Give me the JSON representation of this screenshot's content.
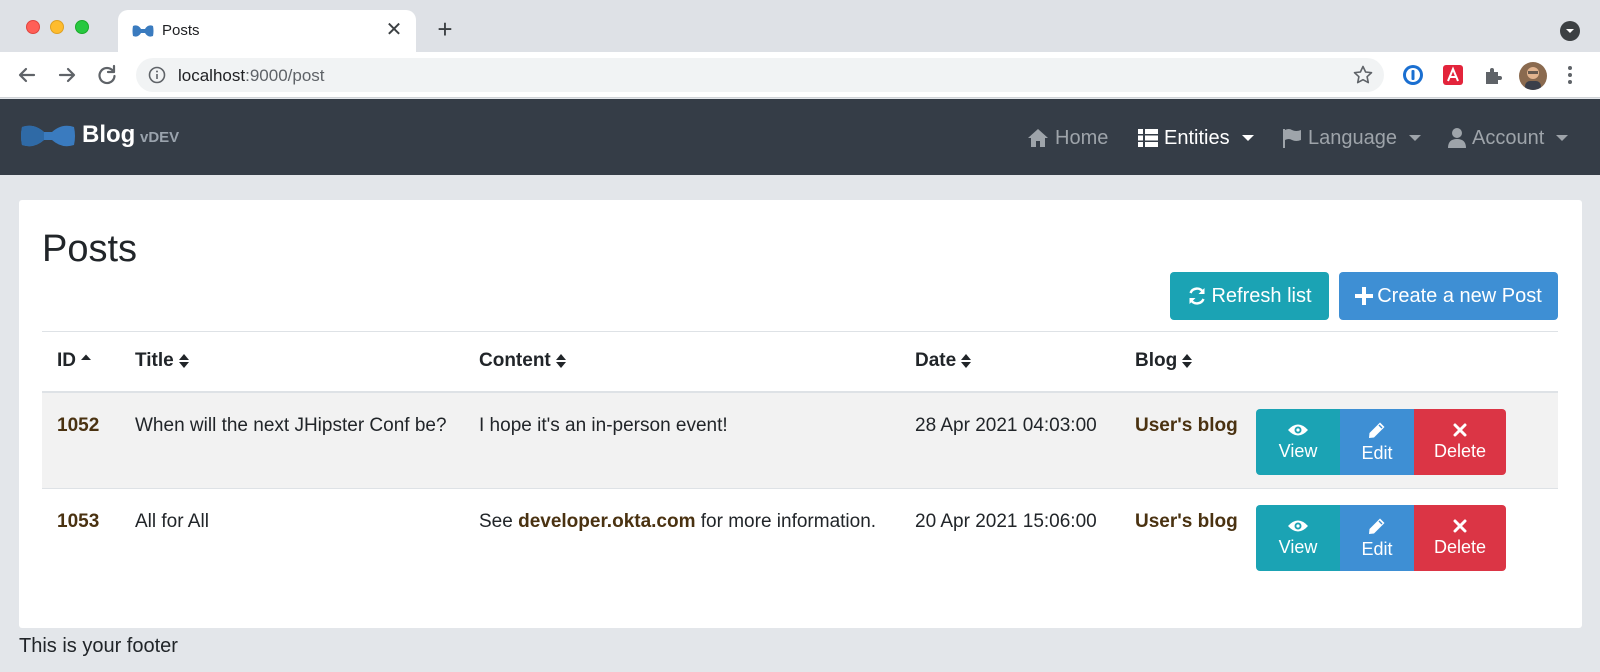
{
  "browser": {
    "tab_title": "Posts",
    "url_host": "localhost",
    "url_rest": ":9000/post"
  },
  "navbar": {
    "brand_title": "Blog",
    "brand_version": "vDEV",
    "items": [
      {
        "label": "Home",
        "icon": "home-icon"
      },
      {
        "label": "Entities",
        "icon": "th-list-icon"
      },
      {
        "label": "Language",
        "icon": "flag-icon"
      },
      {
        "label": "Account",
        "icon": "user-icon"
      }
    ]
  },
  "main": {
    "title": "Posts",
    "refresh_label": "Refresh list",
    "create_label": "Create a new Post",
    "columns": [
      "ID",
      "Title",
      "Content",
      "Date",
      "Blog"
    ],
    "rows": [
      {
        "id": "1052",
        "title": "When will the next JHipster Conf be?",
        "content_pre": "I hope it's an in-person event!",
        "content_link": "",
        "content_post": "",
        "date": "28 Apr 2021 04:03:00",
        "blog": "User's blog"
      },
      {
        "id": "1053",
        "title": "All for All",
        "content_pre": "See ",
        "content_link": "developer.okta.com",
        "content_post": " for more information.",
        "date": "20 Apr 2021 15:06:00",
        "blog": "User's blog"
      }
    ],
    "actions": {
      "view": "View",
      "edit": "Edit",
      "delete": "Delete"
    }
  },
  "footer": {
    "text": "This is your footer"
  },
  "colors": {
    "navbar": "#353d47",
    "info": "#1ba3b4",
    "primary": "#3e8fd4",
    "danger": "#db3545"
  }
}
